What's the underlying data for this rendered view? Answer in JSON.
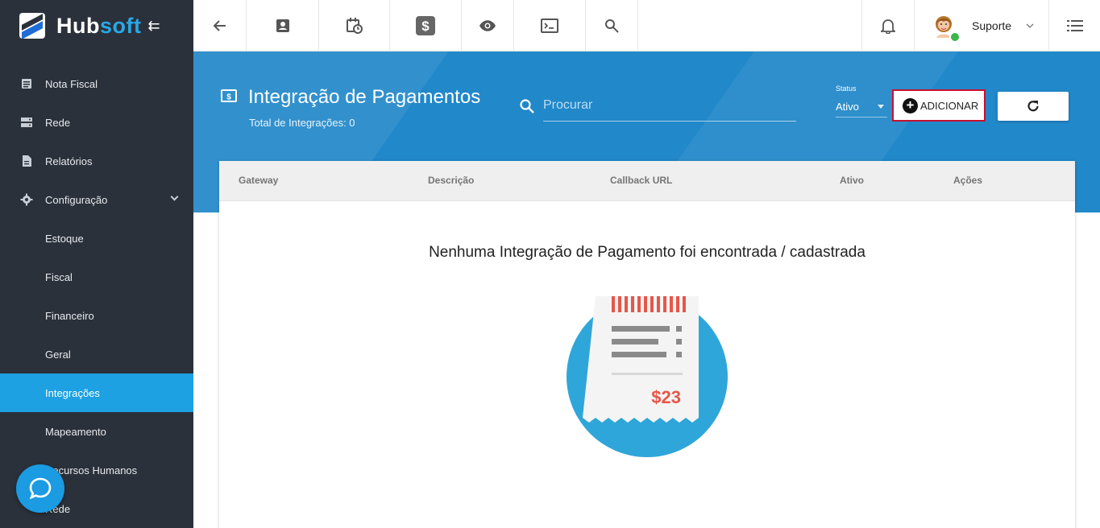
{
  "brand": {
    "hub": "Hub",
    "soft": "soft"
  },
  "sidebar": {
    "items": [
      {
        "label": "Nota Fiscal",
        "icon": "document-icon"
      },
      {
        "label": "Rede",
        "icon": "server-icon"
      },
      {
        "label": "Relatórios",
        "icon": "file-icon"
      },
      {
        "label": "Configuração",
        "icon": "gear-icon",
        "expanded": true
      },
      {
        "label": "Estoque"
      },
      {
        "label": "Fiscal"
      },
      {
        "label": "Financeiro"
      },
      {
        "label": "Geral"
      },
      {
        "label": "Integrações",
        "active": true
      },
      {
        "label": "Mapeamento"
      },
      {
        "label": "Recursos Humanos"
      },
      {
        "label": "Rede"
      }
    ]
  },
  "topbar": {
    "icons": [
      "back-arrow-icon",
      "contact-card-icon",
      "calendar-clock-icon",
      "dollar-icon",
      "eye-icon",
      "terminal-icon",
      "search-icon"
    ],
    "notifications_icon": "bell-icon",
    "user_name": "Suporte",
    "menu_icon": "list-icon"
  },
  "header": {
    "title": "Integração de Pagamentos",
    "subtitle": "Total de Integrações: 0",
    "search_placeholder": "Procurar",
    "status_label": "Status",
    "status_value": "Ativo",
    "add_label": "ADICIONAR"
  },
  "table": {
    "columns": [
      "Gateway",
      "Descrição",
      "Callback URL",
      "Ativo",
      "Ações"
    ],
    "empty_message": "Nenhuma Integração de Pagamento foi encontrada / cadastrada"
  },
  "illustration": {
    "receipt_amount": "$23"
  },
  "colors": {
    "accent": "#1da1e2",
    "band": "#2188c9",
    "sidebar": "#2b313a",
    "highlight": "#c8102e"
  }
}
